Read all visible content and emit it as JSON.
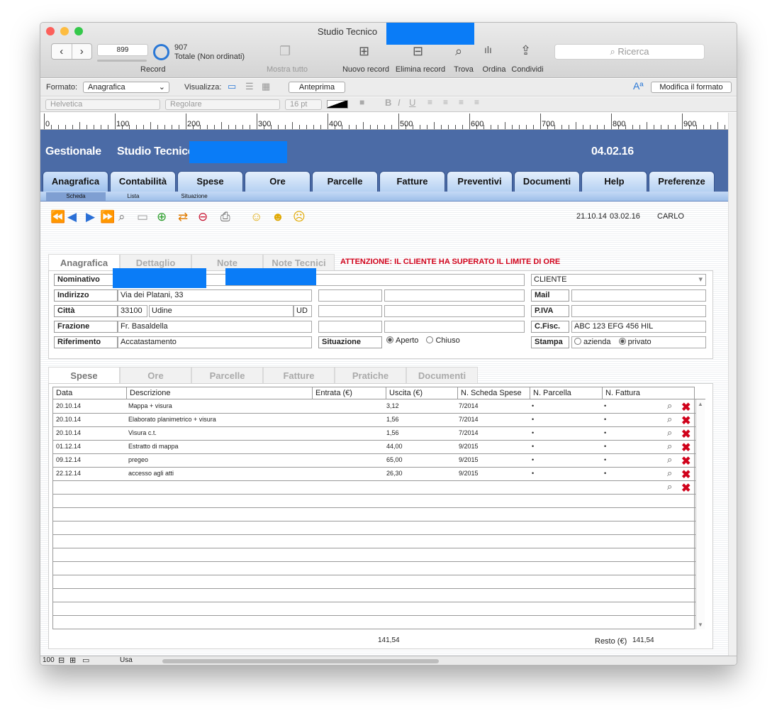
{
  "window": {
    "title": "Studio Tecnico",
    "traffic_colors": [
      "#fc605b",
      "#fdbc40",
      "#34c84a"
    ]
  },
  "toolbar": {
    "record_number": "899",
    "total_count": "907",
    "total_label": "Totale (Non ordinati)",
    "record_label": "Record",
    "show_all": "Mostra tutto",
    "new_record": "Nuovo record",
    "delete_record": "Elimina record",
    "find": "Trova",
    "sort": "Ordina",
    "share": "Condividi",
    "search_placeholder": "Ricerca"
  },
  "format_bar": {
    "format_label": "Formato:",
    "format_value": "Anagrafica",
    "view_label": "Visualizza:",
    "preview": "Anteprima",
    "edit_format": "Modifica il formato"
  },
  "style_bar": {
    "font": "Helvetica",
    "style": "Regolare",
    "size": "16 pt"
  },
  "ruler": {
    "marks": [
      "0",
      "100",
      "200",
      "300",
      "400",
      "500",
      "600",
      "700",
      "800",
      "900"
    ]
  },
  "app_header": {
    "app_name": "Gestionale",
    "company": "Studio Tecnico",
    "date": "04.02.16"
  },
  "main_tabs": [
    "Anagrafica",
    "Contabilità",
    "Spese",
    "Ore",
    "Parcelle",
    "Fatture",
    "Preventivi",
    "Documenti",
    "Help",
    "Preferenze"
  ],
  "sub_tabs": [
    "Scheda",
    "Lista",
    "Situazione"
  ],
  "record_info": {
    "created": "21.10.14",
    "modified": "03.02.16",
    "user": "CARLO"
  },
  "detail_tabs": [
    "Anagrafica",
    "Dettaglio",
    "Note",
    "Note Tecnici"
  ],
  "warning": "ATTENZIONE: IL CLIENTE HA SUPERATO IL LIMITE DI ORE",
  "form": {
    "nominativo_label": "Nominativo",
    "indirizzo_label": "Indirizzo",
    "indirizzo": "Via dei Platani, 33",
    "citta_label": "Città",
    "cap": "33100",
    "citta": "Udine",
    "provincia": "UD",
    "frazione_label": "Frazione",
    "frazione": "Fr. Basaldella",
    "riferimento_label": "Riferimento",
    "riferimento": "Accatastamento",
    "situazione_label": "Situazione",
    "situazione_options": [
      "Aperto",
      "Chiuso"
    ],
    "tipo": "CLIENTE",
    "mail_label": "Mail",
    "piva_label": "P.IVA",
    "cfisc_label": "C.Fisc.",
    "cfisc": "ABC 123 EFG 456 HIL",
    "stampa_label": "Stampa",
    "stampa_options": [
      "azienda",
      "privato"
    ]
  },
  "bottom_tabs": [
    "Spese",
    "Ore",
    "Parcelle",
    "Fatture",
    "Pratiche",
    "Documenti"
  ],
  "table": {
    "headers": [
      "Data",
      "Descrizione",
      "Entrata (€)",
      "Uscita (€)",
      "N. Scheda Spese",
      "N. Parcella",
      "N. Fattura"
    ],
    "rows": [
      {
        "data": "20.10.14",
        "descrizione": "Mappa + visura",
        "entrata": "",
        "uscita": "3,12",
        "scheda": "7/2014",
        "parcella": "•",
        "fattura": "•"
      },
      {
        "data": "20.10.14",
        "descrizione": "Elaborato planimetrico + visura",
        "entrata": "",
        "uscita": "1,56",
        "scheda": "7/2014",
        "parcella": "•",
        "fattura": "•"
      },
      {
        "data": "20.10.14",
        "descrizione": "Visura c.t.",
        "entrata": "",
        "uscita": "1,56",
        "scheda": "7/2014",
        "parcella": "•",
        "fattura": "•"
      },
      {
        "data": "01.12.14",
        "descrizione": "Estratto di mappa",
        "entrata": "",
        "uscita": "44,00",
        "scheda": "9/2015",
        "parcella": "•",
        "fattura": "•"
      },
      {
        "data": "09.12.14",
        "descrizione": "pregeo",
        "entrata": "",
        "uscita": "65,00",
        "scheda": "9/2015",
        "parcella": "•",
        "fattura": "•"
      },
      {
        "data": "22.12.14",
        "descrizione": "accesso agli atti",
        "entrata": "",
        "uscita": "26,30",
        "scheda": "9/2015",
        "parcella": "•",
        "fattura": "•"
      }
    ],
    "total_uscita": "141,54",
    "resto_label": "Resto (€)",
    "resto": "141,54"
  },
  "status_bar": {
    "zoom": "100",
    "mode": "Usa"
  },
  "colors": {
    "header_blue": "#4b6ba6",
    "redaction": "#0a7cf7",
    "warning_red": "#d0021b"
  }
}
